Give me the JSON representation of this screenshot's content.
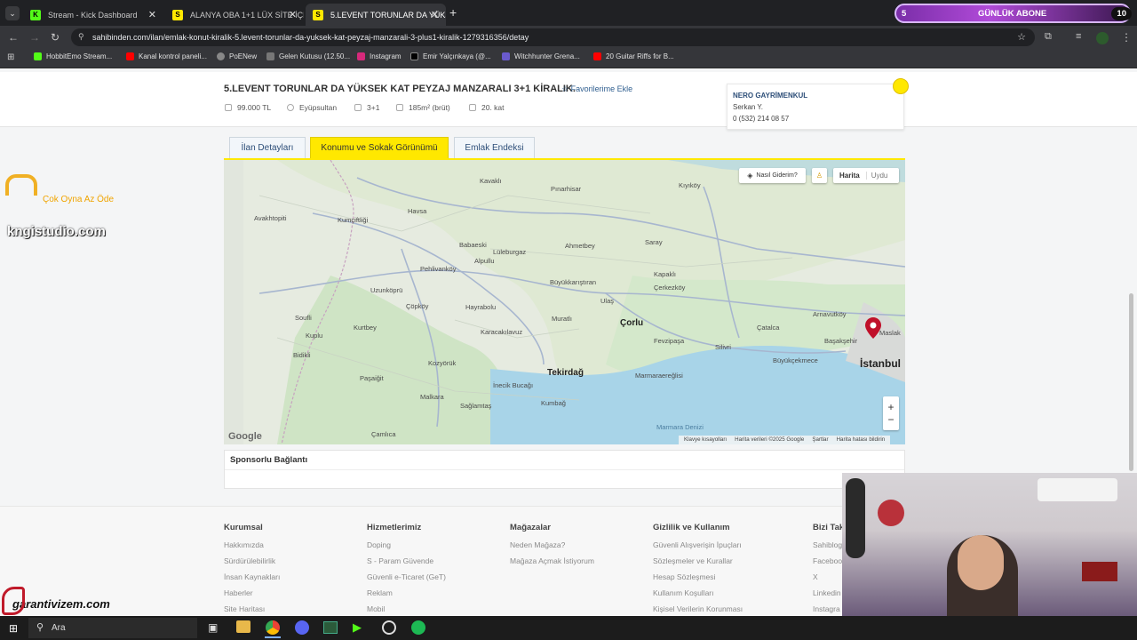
{
  "browser": {
    "tabs": [
      {
        "label": "Stream - Kick Dashboard",
        "icon": "kick-icon"
      },
      {
        "label": "ALANYA OBA 1+1 LÜX SİTE İÇE",
        "icon": "sahibinden-icon"
      },
      {
        "label": "5.LEVENT TORUNLAR DA YÜKS",
        "icon": "sahibinden-icon"
      }
    ],
    "url": "sahibinden.com/ilan/emlak-konut-kiralik-5.levent-torunlar-da-yuksek-kat-peyzaj-manzarali-3-plus1-kiralik-1279316356/detay",
    "bookmarks": [
      "HobbitEmo Stream...",
      "Kanal kontrol paneli...",
      "PoENew",
      "Gelen Kutusu (12.50...",
      "Instagram",
      "Emir Yalçınkaya (@...",
      "Witchhunter Grena...",
      "20 Guitar Riffs for B..."
    ]
  },
  "listing": {
    "title": "5.LEVENT TORUNLAR DA YÜKSEK KAT PEYZAJ MANZARALI 3+1 KİRALIK.",
    "favorite": "Favorilerime Ekle",
    "price": "99.000 TL",
    "district": "Eyüpsultan",
    "rooms": "3+1",
    "area": "185m² (brüt)",
    "floor": "20. kat"
  },
  "agent": {
    "company": "NERO GAYRİMENKUL",
    "person": "Serkan Y.",
    "phone": "0 (532) 214 08 57"
  },
  "subtabs": [
    "İlan Detayları",
    "Konumu ve Sokak Görünümü",
    "Emlak Endeksi"
  ],
  "map": {
    "directions": "Nasıl Giderim?",
    "map_type": "Harita",
    "satellite": "Uydu",
    "zoom_in": "+",
    "zoom_out": "−",
    "attribution": [
      "Klavye kısayolları",
      "Harita verileri ©2025 Google",
      "Şartlar",
      "Harita hatası bildirin"
    ],
    "google": "Google",
    "places": [
      "Kavaklı",
      "Pınarhisar",
      "Kıyıköy",
      "Havsa",
      "Babaeski",
      "Lüleburgaz",
      "Ahmetbey",
      "Saray",
      "Alpullu",
      "Pehlivanköy",
      "Kapaklı",
      "Çerkezköy",
      "Büyükkarıştıran",
      "Uzunköprü",
      "Çöpköy",
      "Hayrabolu",
      "Ulaş",
      "Arnavutköy",
      "Muratlı",
      "Çorlu",
      "Çatalca",
      "Başakşehir",
      "Kurtbey",
      "Karacakılavuz",
      "Fevzipaşa",
      "Silivri",
      "Büyükçekmece",
      "Kozyörük",
      "Tekirdağ",
      "Marmaraereğlisi",
      "Paşaiğit",
      "İnecik Bucağı",
      "Malkara",
      "Kumbağ",
      "Sağlamtaş",
      "Çamlıca",
      "Marmara Denizi",
      "Bidikli",
      "Kuplu",
      "Soufli",
      "Kumçiftliği",
      "Avakhtopiti"
    ],
    "cities": [
      "İstanbul",
      "Tekirdağ",
      "Çorlu"
    ],
    "pin_label": "Maslak"
  },
  "sponsored": "Sponsorlu Bağlantı",
  "footer": [
    {
      "title": "Kurumsal",
      "items": [
        "Hakkımızda",
        "Sürdürülebilirlik",
        "İnsan Kaynakları",
        "Haberler",
        "Site Haritası"
      ]
    },
    {
      "title": "Hizmetlerimiz",
      "items": [
        "Doping",
        "S - Param Güvende",
        "Güvenli e-Ticaret (GeT)",
        "Reklam",
        "Mobil"
      ]
    },
    {
      "title": "Mağazalar",
      "items": [
        "Neden Mağaza?",
        "Mağaza Açmak İstiyorum"
      ]
    },
    {
      "title": "Gizlilik ve Kullanım",
      "items": [
        "Güvenli Alışverişin İpuçları",
        "Sözleşmeler ve Kurallar",
        "Hesap Sözleşmesi",
        "Kullanım Koşulları",
        "Kişisel Verilerin Korunması"
      ]
    },
    {
      "title": "Bizi Tak",
      "items": [
        "Sahiblog",
        "Faceboo",
        "X",
        "Linkedin",
        "Instagra"
      ]
    }
  ],
  "overlay": {
    "abone_count": "5",
    "abone_label": "GÜNLÜK ABONE",
    "abone_total": "10",
    "sponsor_logo": "Çok Oyna  Az Öde",
    "studio": "kngistudio.com",
    "garanti": "garantivizem.com"
  },
  "taskbar": {
    "search": "Ara"
  },
  "colors": {
    "accent_yellow": "#ffe800",
    "link_blue": "#2f5e8f",
    "pin_red": "#c0102a"
  }
}
